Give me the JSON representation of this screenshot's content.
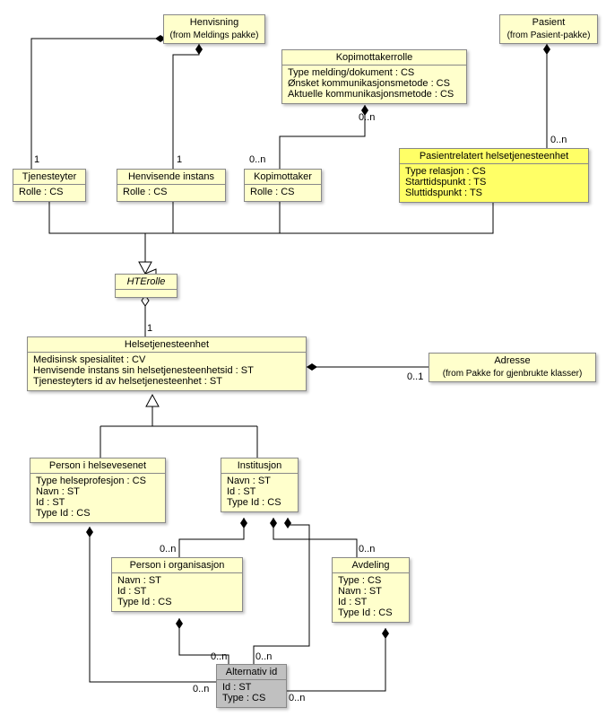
{
  "classes": {
    "henvisning": {
      "title": "Henvisning",
      "subtitle": "(from Meldings pakke)"
    },
    "kopimottakerrolle": {
      "title": "Kopimottakerrolle",
      "attrs": [
        "Type melding/dokument : CS",
        "Ønsket kommunikasjonsmetode : CS",
        "Aktuelle kommunikasjonsmetode : CS"
      ]
    },
    "pasient": {
      "title": "Pasient",
      "subtitle": "(from Pasient-pakke)"
    },
    "tjenesteyter": {
      "title": "Tjenesteyter",
      "attrs": [
        "Rolle : CS"
      ]
    },
    "henvisende_instans": {
      "title": "Henvisende instans",
      "attrs": [
        "Rolle : CS"
      ]
    },
    "kopimottaker": {
      "title": "Kopimottaker",
      "attrs": [
        "Rolle : CS"
      ]
    },
    "pasientrelatert": {
      "title": "Pasientrelatert helsetjenesteenhet",
      "attrs": [
        "Type relasjon : CS",
        "Starttidspunkt : TS",
        "Sluttidspunkt : TS"
      ]
    },
    "hterolle": {
      "title": "HTErolle"
    },
    "helsetjenesteenhet": {
      "title": "Helsetjenesteenhet",
      "attrs": [
        "Medisinsk spesialitet : CV",
        "Henvisende instans sin helsetjenesteenhetsid : ST",
        "Tjenesteyters id av helsetjenesteenhet : ST"
      ]
    },
    "adresse": {
      "title": "Adresse",
      "subtitle": "(from Pakke for gjenbrukte klasser)"
    },
    "person_helsevesenet": {
      "title": "Person i helsevesenet",
      "attrs": [
        "Type helseprofesjon : CS",
        "Navn : ST",
        "Id : ST",
        "Type Id : CS"
      ]
    },
    "institusjon": {
      "title": "Institusjon",
      "attrs": [
        "Navn : ST",
        "Id : ST",
        "Type Id : CS"
      ]
    },
    "person_organisasjon": {
      "title": "Person i organisasjon",
      "attrs": [
        "Navn : ST",
        "Id : ST",
        "Type Id : CS"
      ]
    },
    "avdeling": {
      "title": "Avdeling",
      "attrs": [
        "Type : CS",
        "Navn : ST",
        "Id : ST",
        "Type Id : CS"
      ]
    },
    "alternativ_id": {
      "title": "Alternativ id",
      "attrs": [
        "Id : ST",
        "Type : CS"
      ]
    }
  },
  "mult": {
    "one_a": "1",
    "one_b": "1",
    "zero_n_a": "0..n",
    "zero_n_b": "0..n",
    "zero_n_c": "0..n",
    "one_c": "1",
    "zero_one": "0..1",
    "zero_n_d": "0..n",
    "zero_n_e": "0..n",
    "zero_n_f": "0..n",
    "zero_n_g": "0..n",
    "zero_n_h": "0..n",
    "zero_n_i": "0..n"
  }
}
